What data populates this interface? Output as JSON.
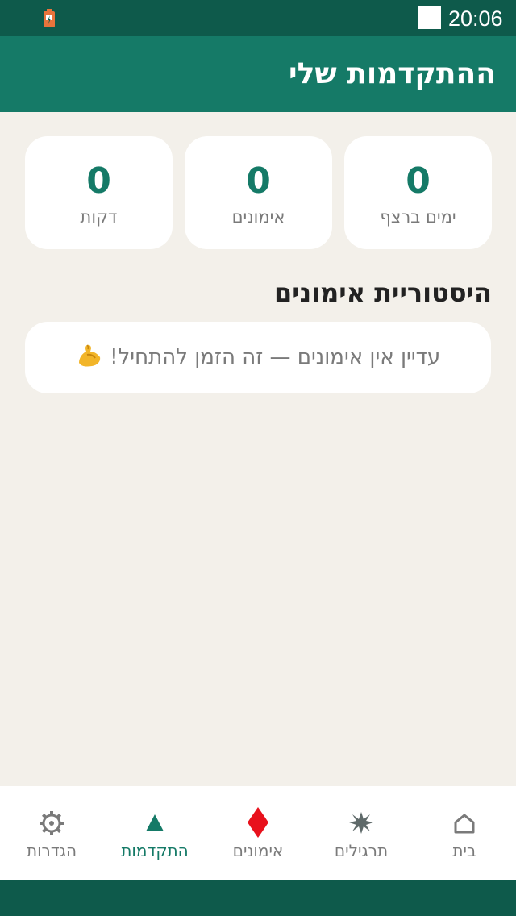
{
  "status_bar": {
    "time": "20:06",
    "battery_icon": "battery-charging-icon"
  },
  "app_bar": {
    "title": "ההתקדמות שלי"
  },
  "stats": [
    {
      "value": "0",
      "label": "ימים ברצף"
    },
    {
      "value": "0",
      "label": "אימונים"
    },
    {
      "value": "0",
      "label": "דקות"
    }
  ],
  "history": {
    "title": "היסטוריית אימונים",
    "empty_text": "עדיין אין אימונים — זה הזמן להתחיל!",
    "empty_icon": "flexed-biceps-icon"
  },
  "bottom_nav": {
    "items": [
      {
        "label": "בית",
        "icon": "home-icon",
        "active": false
      },
      {
        "label": "תרגילים",
        "icon": "star-burst-icon",
        "active": false
      },
      {
        "label": "אימונים",
        "icon": "diamond-icon",
        "active": false
      },
      {
        "label": "התקדמות",
        "icon": "triangle-up-icon",
        "active": true
      },
      {
        "label": "הגדרות",
        "icon": "gear-icon",
        "active": false
      }
    ]
  },
  "colors": {
    "primary": "#157a67",
    "primary_dark": "#0e5a4b",
    "background": "#f3f0ea",
    "card": "#ffffff",
    "muted_text": "#7a7a7a",
    "diamond": "#e8111c"
  }
}
